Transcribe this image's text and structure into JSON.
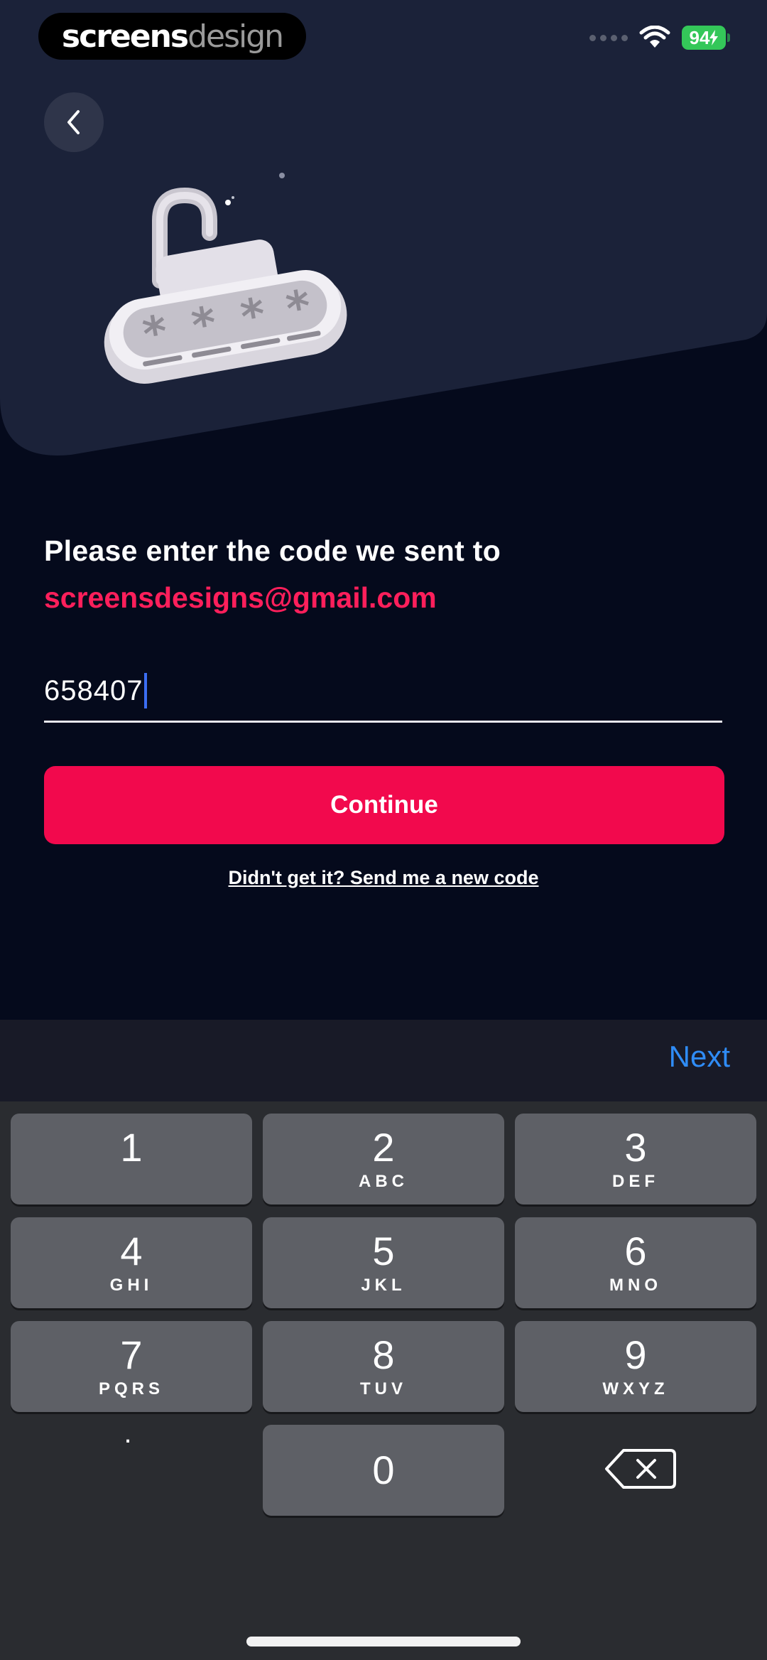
{
  "watermark": {
    "part1": "screens",
    "part2": "design"
  },
  "status_bar": {
    "battery": "94",
    "wifi_icon": "wifi-icon",
    "battery_color": "#34c759"
  },
  "nav": {
    "back_icon": "chevron-left-icon"
  },
  "illustration": {
    "icon": "padlock-password-icon"
  },
  "prompt": {
    "heading": "Please enter the code we sent to",
    "email": "screensdesigns@gmail.com"
  },
  "code_input": {
    "value": "658407"
  },
  "actions": {
    "continue_label": "Continue",
    "resend_label": "Didn't get it? Send me a new code"
  },
  "keyboard": {
    "toolbar_next": "Next",
    "keys": [
      {
        "num": "1",
        "letters": ""
      },
      {
        "num": "2",
        "letters": "ABC"
      },
      {
        "num": "3",
        "letters": "DEF"
      },
      {
        "num": "4",
        "letters": "GHI"
      },
      {
        "num": "5",
        "letters": "JKL"
      },
      {
        "num": "6",
        "letters": "MNO"
      },
      {
        "num": "7",
        "letters": "PQRS"
      },
      {
        "num": "8",
        "letters": "TUV"
      },
      {
        "num": "9",
        "letters": "WXYZ"
      },
      {
        "num": "0",
        "letters": ""
      }
    ],
    "dot_key": ".",
    "delete_icon": "backspace-icon"
  },
  "colors": {
    "accent": "#f2094d",
    "email_text": "#ff1f5b",
    "background": "#050a1c",
    "next_link": "#2f8cf6"
  }
}
